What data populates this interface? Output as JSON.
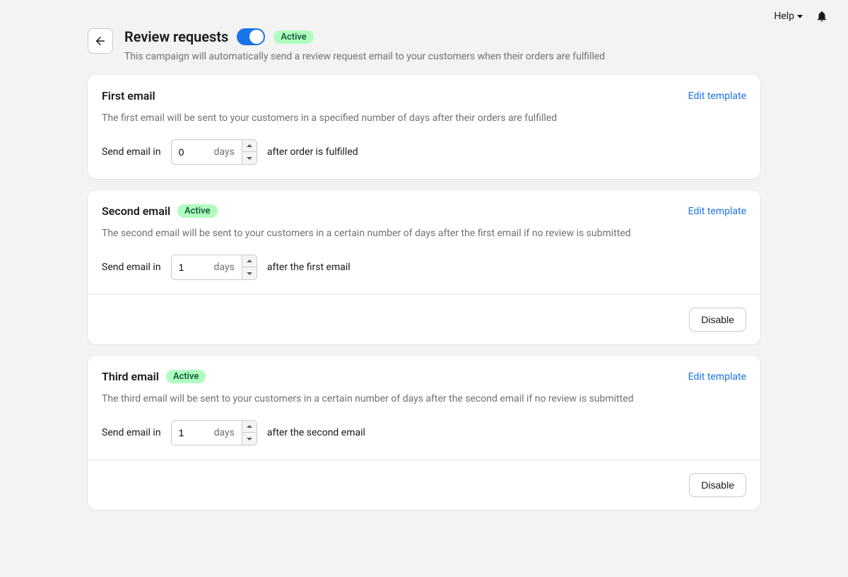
{
  "topbar": {
    "help_label": "Help"
  },
  "header": {
    "title": "Review requests",
    "status_badge": "Active",
    "subtitle": "This campaign will automatically send a review request email to your customers when their orders are fulfilled"
  },
  "common": {
    "edit_template_label": "Edit template",
    "send_email_in_label": "Send email in",
    "days_label": "days",
    "disable_label": "Disable"
  },
  "cards": {
    "first": {
      "title": "First email",
      "desc": "The first email will be sent to your customers in a specified number of days after their orders are fulfilled",
      "value": "0",
      "after_text": "after order is fulfilled"
    },
    "second": {
      "title": "Second email",
      "badge": "Active",
      "desc": "The second email will be sent to your customers in a certain number of days after the first email if no review is submitted",
      "value": "1",
      "after_text": "after the first email"
    },
    "third": {
      "title": "Third email",
      "badge": "Active",
      "desc": "The third email will be sent to your customers in a certain number of days after the second email if no review is submitted",
      "value": "1",
      "after_text": "after the second email"
    }
  }
}
